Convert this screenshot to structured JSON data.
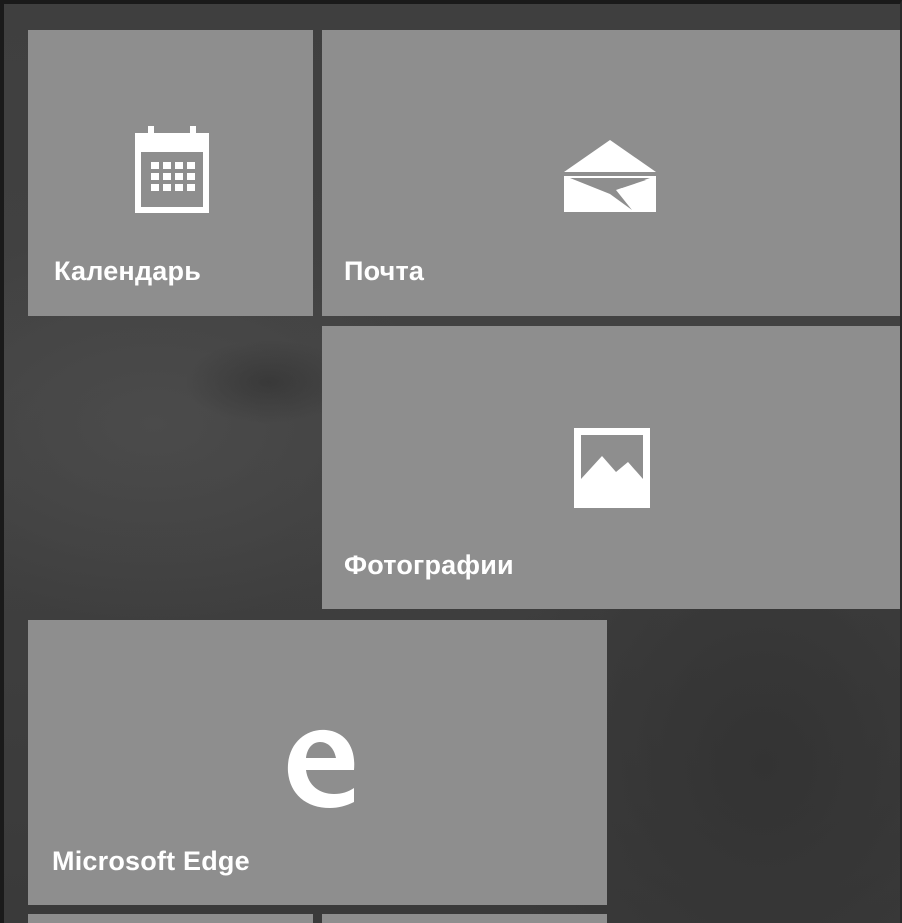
{
  "start_tiles": [
    {
      "label": "Календарь",
      "icon": "calendar-icon"
    },
    {
      "label": "Почта",
      "icon": "mail-icon"
    },
    {
      "label": "Фотографии",
      "icon": "photos-icon"
    },
    {
      "label": "Microsoft Edge",
      "icon": "edge-icon"
    }
  ],
  "colors": {
    "tile_background": "#8e8e8e",
    "desktop_background": "#3f3f3f",
    "tile_text": "#ffffff"
  }
}
